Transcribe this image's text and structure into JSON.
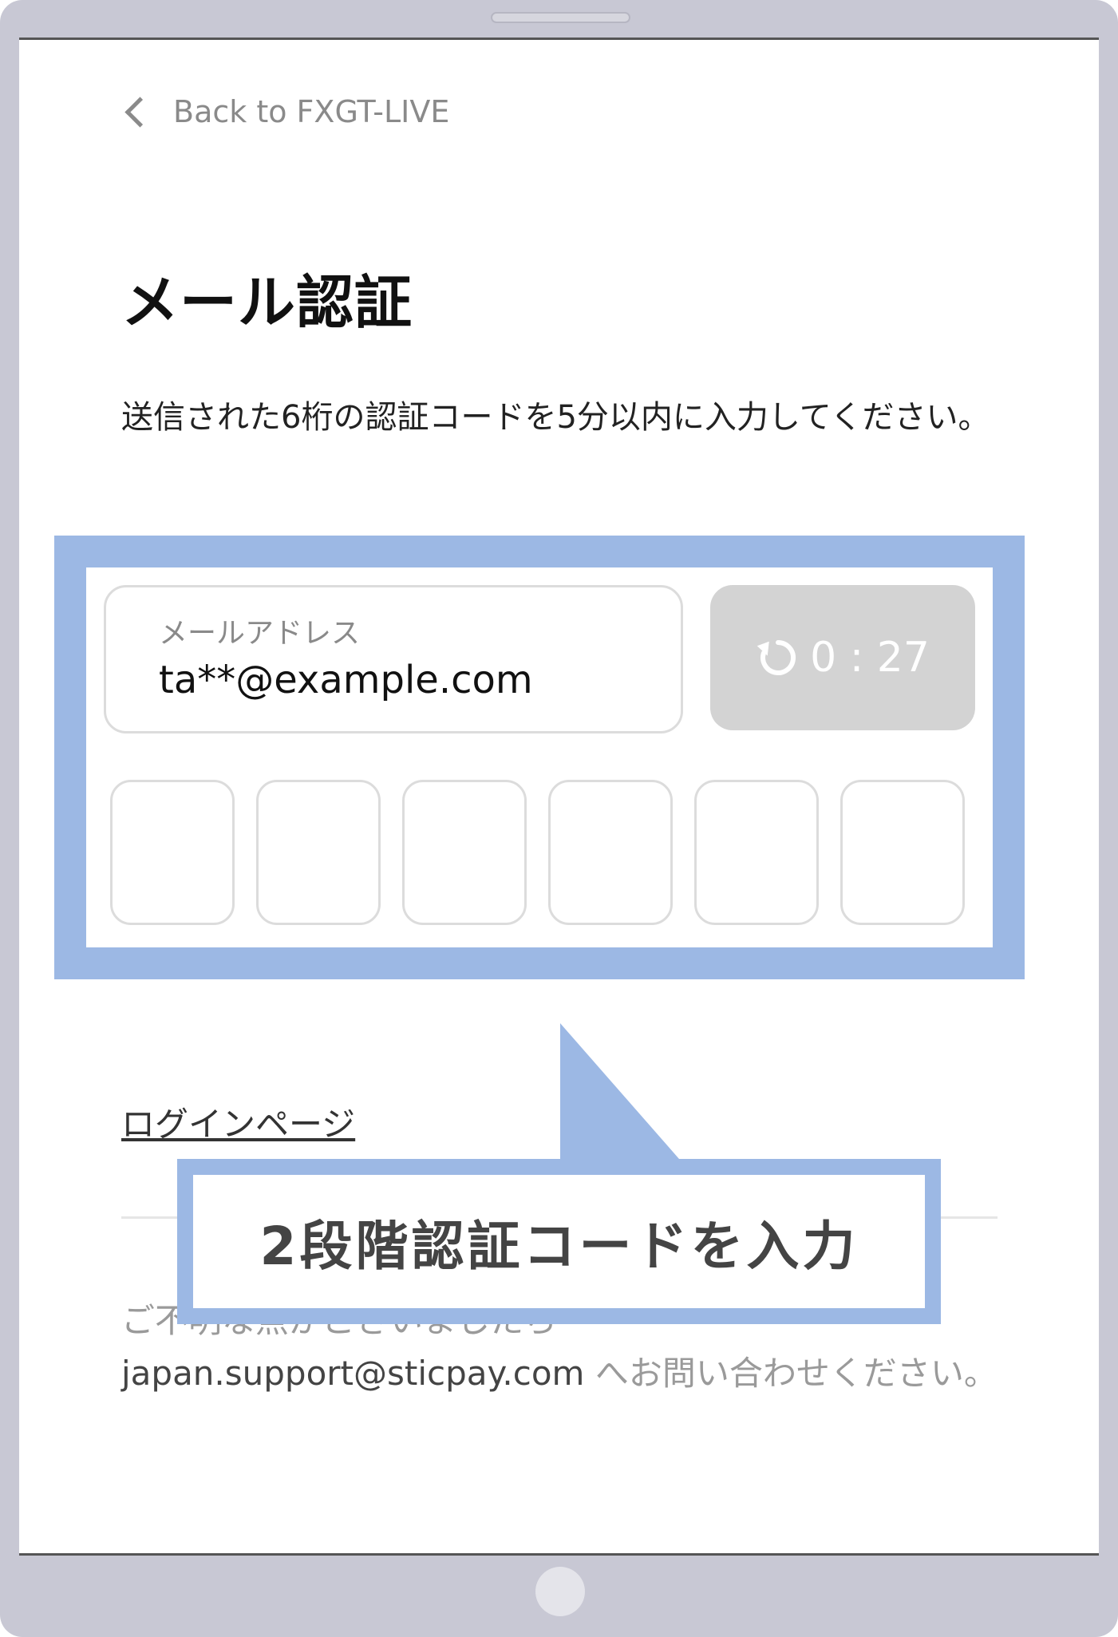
{
  "back_link": {
    "label": "Back to FXGT-LIVE",
    "icon": "chevron-left-icon"
  },
  "page": {
    "title": "メール認証",
    "description": "送信された6桁の認証コードを5分以内に入力してください。"
  },
  "email_field": {
    "label": "メールアドレス",
    "value": "ta**@example.com"
  },
  "resend": {
    "icon": "refresh-icon",
    "timer": "0 : 27"
  },
  "code_inputs": {
    "count": 6,
    "values": [
      "",
      "",
      "",
      "",
      "",
      ""
    ]
  },
  "login_link": {
    "label": "ログインページ"
  },
  "support": {
    "prefix": "ご不明な点がございましたら",
    "email": "japan.support@sticpay.com",
    "suffix": "へお問い合わせください。"
  },
  "callout": {
    "text": "2段階認証コードを入力"
  },
  "colors": {
    "highlight": "#9cb8e4",
    "tablet_frame": "#c8c8d4",
    "button_disabled": "#d3d3d3"
  }
}
